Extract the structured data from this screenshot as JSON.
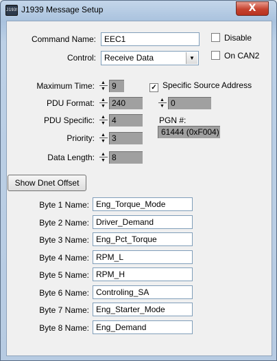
{
  "window": {
    "title": "J1939 Message Setup",
    "icon_text": "J1939",
    "close_glyph": "X"
  },
  "command": {
    "label": "Command Name:",
    "value": "EEC1"
  },
  "disable": {
    "label": "Disable",
    "checked": false
  },
  "control": {
    "label": "Control:",
    "selected": "Receive Data",
    "arrow": "▼"
  },
  "on_can2": {
    "label": "On CAN2",
    "checked": false
  },
  "max_time": {
    "label": "Maximum Time:",
    "value": "9"
  },
  "specific_source": {
    "label": "Specific Source Address",
    "checked": true,
    "mark": "✓"
  },
  "pdu_format": {
    "label": "PDU Format:",
    "value": "240"
  },
  "source_address": {
    "value": "0"
  },
  "pdu_specific": {
    "label": "PDU Specific:",
    "value": "4"
  },
  "pgn": {
    "label": "PGN #:",
    "value": "61444 (0xF004)"
  },
  "priority": {
    "label": "Priority:",
    "value": "3"
  },
  "data_length": {
    "label": "Data Length:",
    "value": "8"
  },
  "show_dnet_button": "Show Dnet Offset",
  "bytes": [
    {
      "label": "Byte 1 Name:",
      "value": "Eng_Torque_Mode"
    },
    {
      "label": "Byte 2 Name:",
      "value": "Driver_Demand"
    },
    {
      "label": "Byte 3 Name:",
      "value": "Eng_Pct_Torque"
    },
    {
      "label": "Byte 4 Name:",
      "value": "RPM_L"
    },
    {
      "label": "Byte 5 Name:",
      "value": "RPM_H"
    },
    {
      "label": "Byte 6 Name:",
      "value": "Controling_SA"
    },
    {
      "label": "Byte 7 Name:",
      "value": "Eng_Starter_Mode"
    },
    {
      "label": "Byte 8 Name:",
      "value": "Eng_Demand"
    }
  ],
  "spinner_arrows": {
    "up": "▲",
    "down": "▼"
  }
}
